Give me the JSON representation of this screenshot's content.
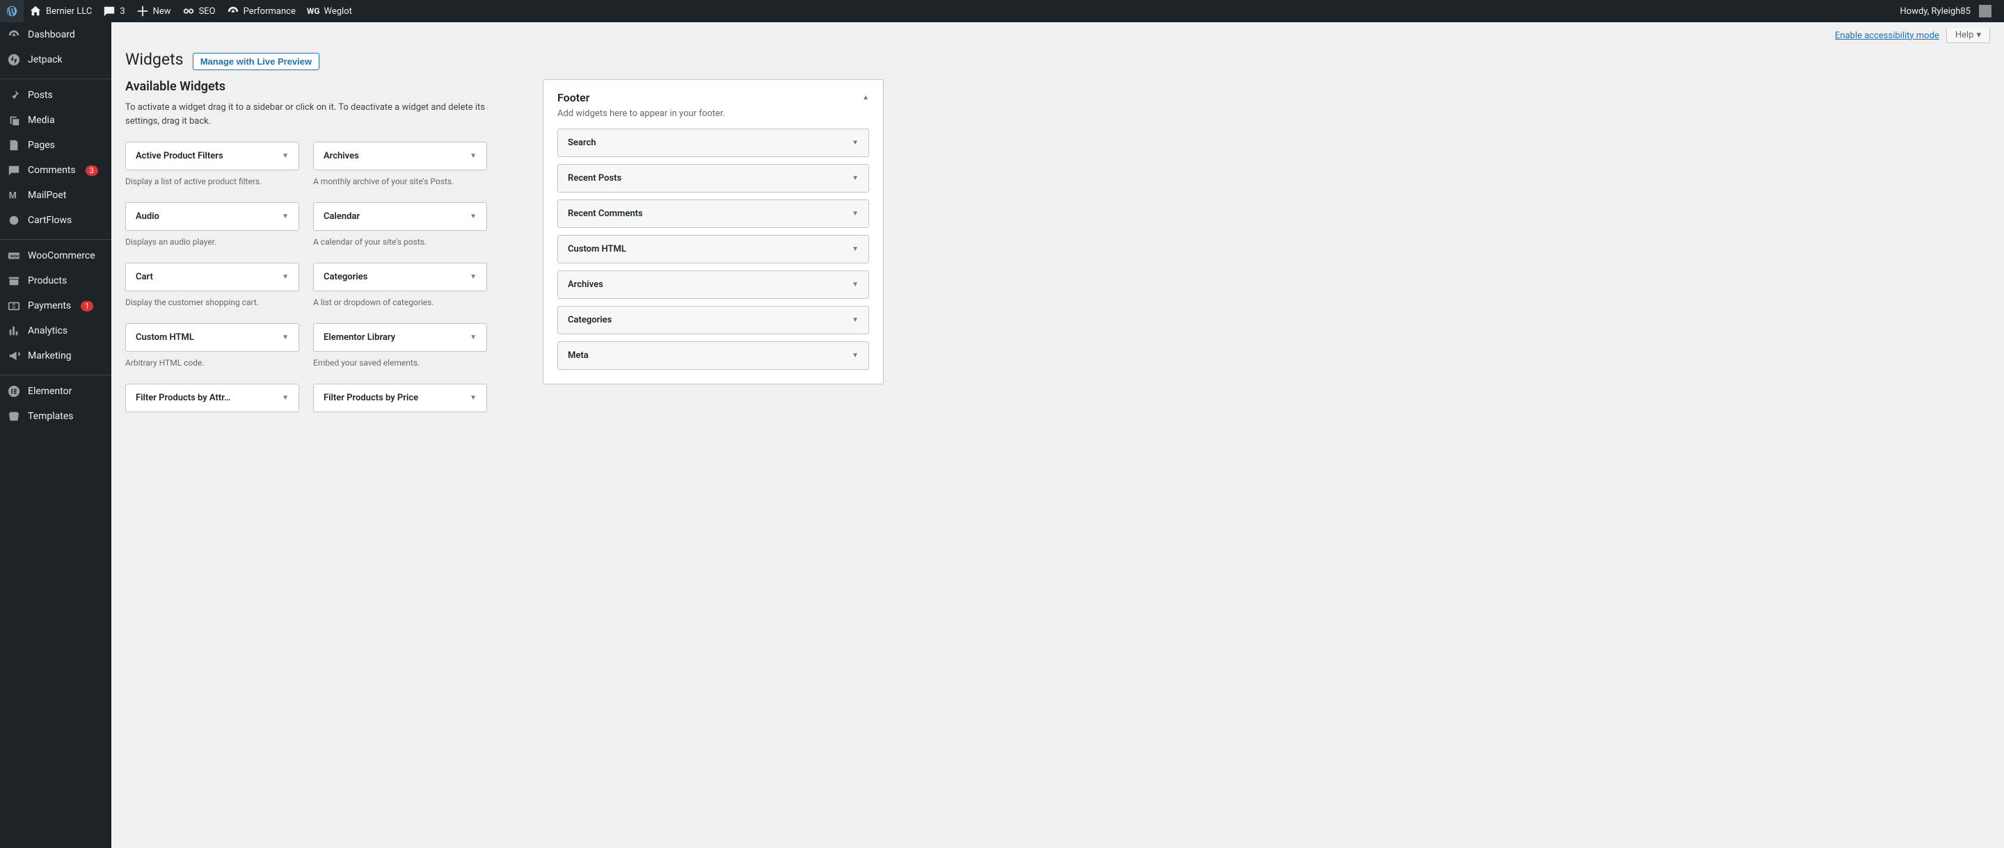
{
  "adminbar": {
    "site_name": "Bernier LLC",
    "comments_count": "3",
    "new_label": "New",
    "seo_label": "SEO",
    "performance_label": "Performance",
    "weglot_label": "Weglot",
    "howdy": "Howdy, Ryleigh85"
  },
  "sidebar": [
    {
      "label": "Dashboard",
      "icon": "dashboard"
    },
    {
      "label": "Jetpack",
      "icon": "jetpack"
    },
    {
      "separator": true
    },
    {
      "label": "Posts",
      "icon": "pin"
    },
    {
      "label": "Media",
      "icon": "media"
    },
    {
      "label": "Pages",
      "icon": "page"
    },
    {
      "label": "Comments",
      "icon": "comment",
      "badge": "3"
    },
    {
      "label": "MailPoet",
      "icon": "mailpoet"
    },
    {
      "label": "CartFlows",
      "icon": "cartflows"
    },
    {
      "separator": true
    },
    {
      "label": "WooCommerce",
      "icon": "woo"
    },
    {
      "label": "Products",
      "icon": "archive"
    },
    {
      "label": "Payments",
      "icon": "payments",
      "badge": "1"
    },
    {
      "label": "Analytics",
      "icon": "chart"
    },
    {
      "label": "Marketing",
      "icon": "megaphone"
    },
    {
      "separator": true
    },
    {
      "label": "Elementor",
      "icon": "elementor"
    },
    {
      "label": "Templates",
      "icon": "templates"
    }
  ],
  "screen_meta": {
    "accessibility_link": "Enable accessibility mode",
    "help_label": "Help"
  },
  "page": {
    "title": "Widgets",
    "manage_btn": "Manage with Live Preview"
  },
  "available": {
    "heading": "Available Widgets",
    "description": "To activate a widget drag it to a sidebar or click on it. To deactivate a widget and delete its settings, drag it back.",
    "widgets": [
      {
        "title": "Active Product Filters",
        "desc": "Display a list of active product filters."
      },
      {
        "title": "Archives",
        "desc": "A monthly archive of your site's Posts."
      },
      {
        "title": "Audio",
        "desc": "Displays an audio player."
      },
      {
        "title": "Calendar",
        "desc": "A calendar of your site's posts."
      },
      {
        "title": "Cart",
        "desc": "Display the customer shopping cart."
      },
      {
        "title": "Categories",
        "desc": "A list or dropdown of categories."
      },
      {
        "title": "Custom HTML",
        "desc": "Arbitrary HTML code."
      },
      {
        "title": "Elementor Library",
        "desc": "Embed your saved elements."
      },
      {
        "title": "Filter Products by Attr…",
        "desc": ""
      },
      {
        "title": "Filter Products by Price",
        "desc": ""
      }
    ]
  },
  "areas": [
    {
      "title": "Footer",
      "desc": "Add widgets here to appear in your footer.",
      "widgets": [
        "Search",
        "Recent Posts",
        "Recent Comments",
        "Custom HTML",
        "Archives",
        "Categories",
        "Meta"
      ]
    }
  ]
}
